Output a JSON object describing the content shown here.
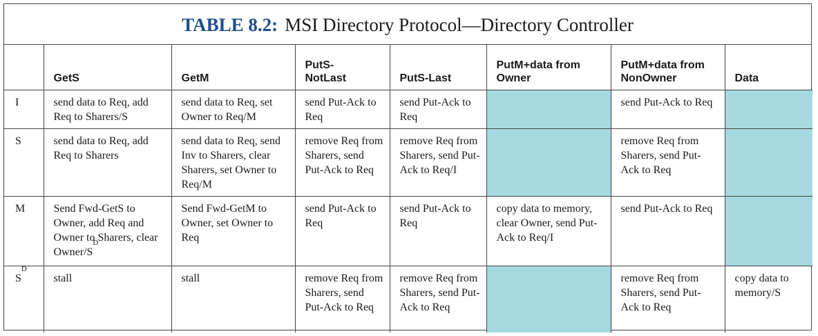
{
  "caption": {
    "label": "TABLE 8.2:",
    "title": "MSI Directory Protocol—Directory Controller"
  },
  "columns": [
    "",
    "GetS",
    "GetM",
    "PutS-\nNotLast",
    "PutS-Last",
    "PutM+data from Owner",
    "PutM+data from NonOwner",
    "Data"
  ],
  "rows": [
    {
      "state": "I",
      "cells": [
        "send data to Req, add Req to Sharers/S",
        "send data to Req, set Owner to Req/M",
        "send Put-Ack to Req",
        "send Put-Ack to Req",
        "",
        "send Put-Ack to Req",
        ""
      ]
    },
    {
      "state": "S",
      "cells": [
        "send data to Req, add Req to Sharers",
        "send data to Req, send Inv to Sharers, clear Sharers, set Owner to Req/M",
        "remove Req from Sharers, send Put-Ack to Req",
        "remove Req from Sharers, send Put-Ack to Req/I",
        "",
        "remove Req from Sharers, send Put-Ack to Req",
        ""
      ]
    },
    {
      "state": "M",
      "cells": [
        "Send Fwd-GetS to Owner, add Req and Owner to Sharers, clear Owner/S",
        "Send Fwd-GetM to Owner, set Owner to Req",
        "send Put-Ack to Req",
        "send Put-Ack to Req",
        "copy data to memory, clear Owner, send Put-Ack to Req/I",
        "send Put-Ack to Req",
        ""
      ],
      "cell0_sup": "D"
    },
    {
      "state": "S",
      "state_sup": "D",
      "cells": [
        "stall",
        "stall",
        "remove Req from Sharers, send Put-Ack to Req",
        "remove Req from Sharers, send Put-Ack to Req",
        "",
        "remove Req from Sharers, send Put-Ack to Req",
        "copy data to memory/S"
      ]
    }
  ],
  "colors": {
    "caption_label": "#1f4e8c",
    "empty_cell": "#a5d9df",
    "border": "#444444"
  }
}
